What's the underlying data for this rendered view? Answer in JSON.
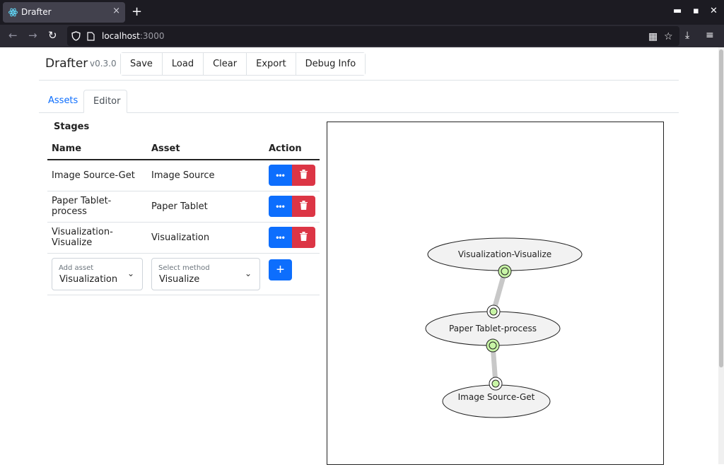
{
  "browser": {
    "tab_title": "Drafter",
    "tab_close": "×",
    "new_tab": "+",
    "url_host": "localhost",
    "url_port": ":3000",
    "icons": [
      "react-favicon-icon",
      "back-icon",
      "forward-icon",
      "reload-icon",
      "shield-icon",
      "page-icon",
      "extensions-icon",
      "bookmark-star-icon",
      "download-icon",
      "menu-icon",
      "minimize-icon",
      "maximize-icon",
      "close-window-icon"
    ]
  },
  "app": {
    "brand": "Drafter",
    "version": "v0.3.0",
    "toolbar": {
      "save": "Save",
      "load": "Load",
      "clear": "Clear",
      "export": "Export",
      "debug": "Debug Info"
    },
    "tabs": {
      "assets": "Assets",
      "editor": "Editor"
    },
    "colors": {
      "primary": "#0d6efd",
      "danger": "#dc3545",
      "port_fill": "#c8f5a6",
      "node_fill": "#f2f2f2"
    }
  },
  "stages": {
    "title": "Stages",
    "columns": {
      "name": "Name",
      "asset": "Asset",
      "action": "Action"
    },
    "rows": [
      {
        "name": "Image Source-Get",
        "asset": "Image Source"
      },
      {
        "name": "Paper Tablet-process",
        "asset": "Paper Tablet"
      },
      {
        "name": "Visualization-Visualize",
        "asset": "Visualization"
      }
    ],
    "more_label": "•••",
    "add_asset": {
      "label": "Add asset",
      "value": "Visualization"
    },
    "select_method": {
      "label": "Select method",
      "value": "Visualize"
    },
    "add_button": "+"
  },
  "graph": {
    "nodes": [
      {
        "label": "Visualization-Visualize"
      },
      {
        "label": "Paper Tablet-process"
      },
      {
        "label": "Image Source-Get"
      }
    ]
  }
}
